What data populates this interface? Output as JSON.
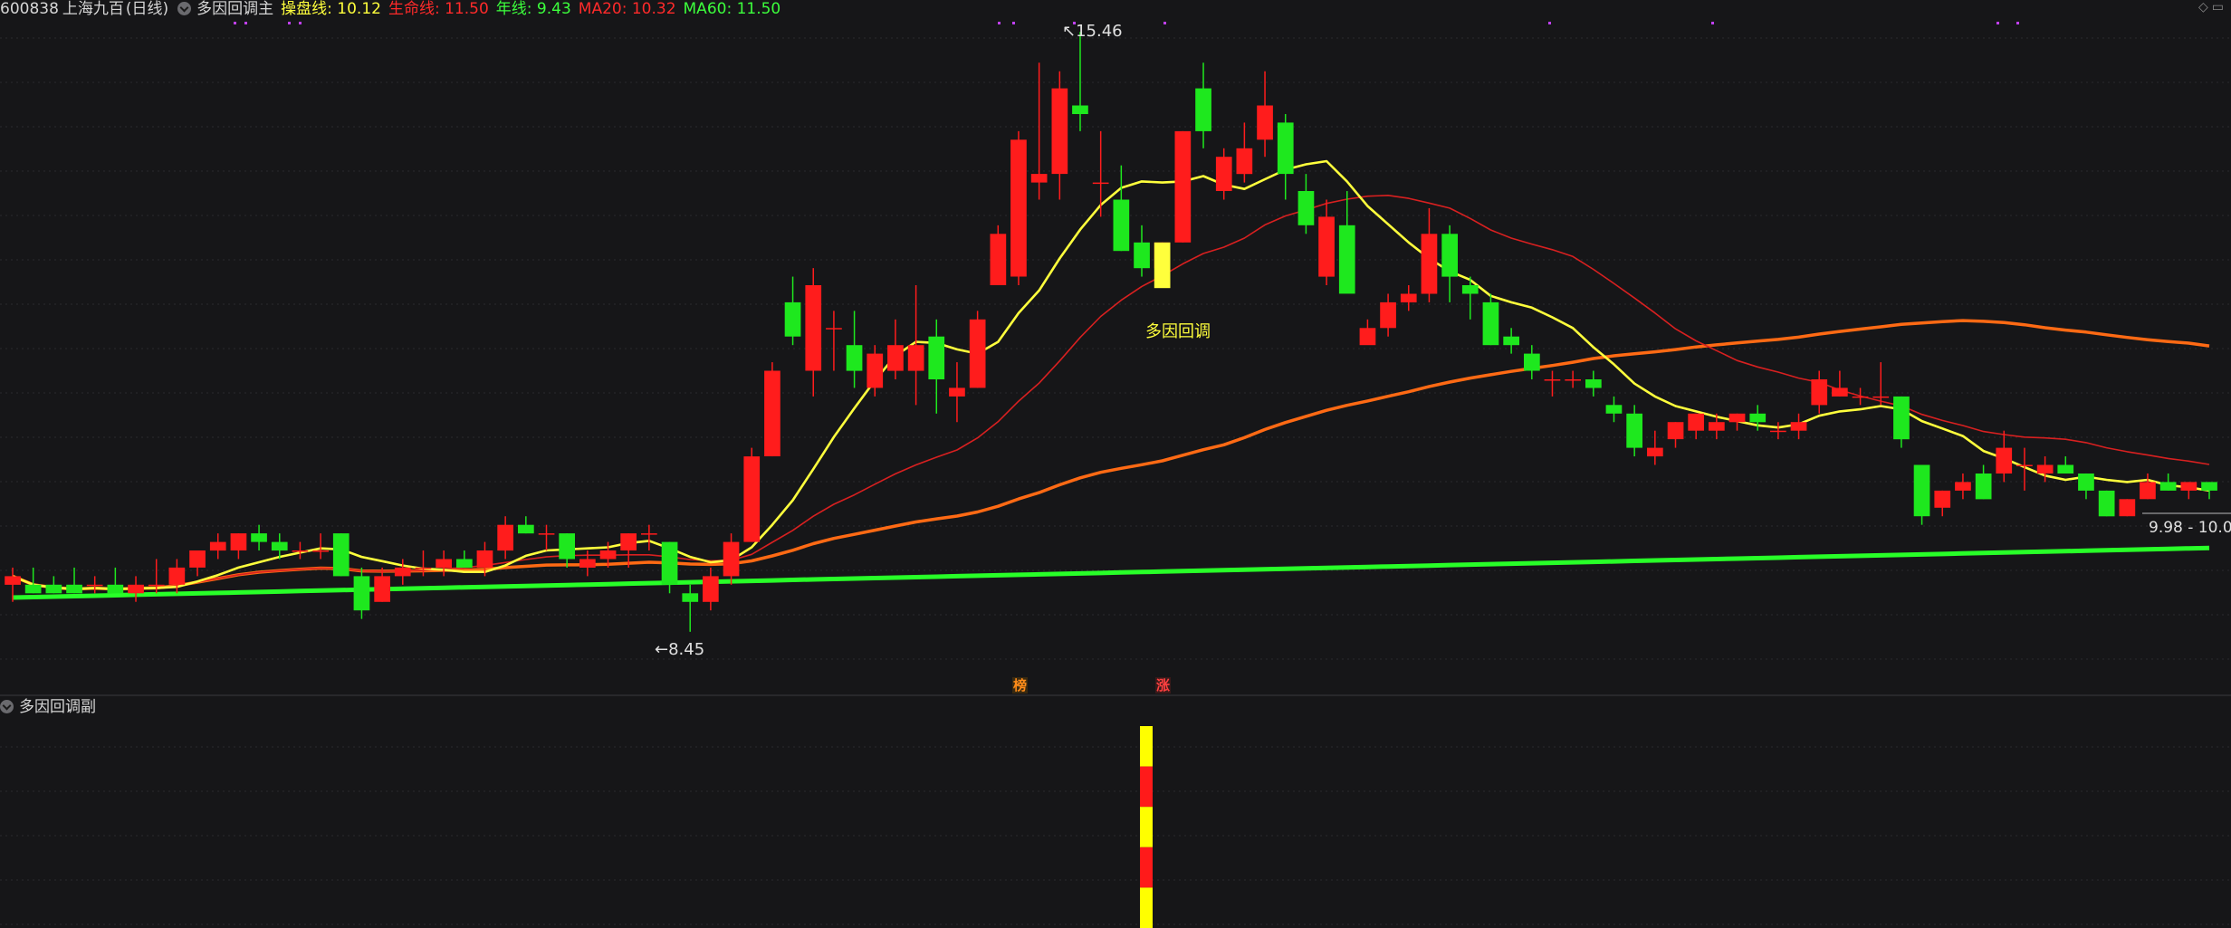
{
  "header": {
    "code": "600838",
    "name": "上海九百",
    "period": "(日线)",
    "indicator_name": "多因回调主",
    "indicators": [
      {
        "label": "操盘线: 10.12",
        "color": "#ffff3c"
      },
      {
        "label": "生命线: 11.50",
        "color": "#ff2a2a"
      },
      {
        "label": "年线: 9.43",
        "color": "#3cff3c"
      },
      {
        "label": "MA20: 10.32",
        "color": "#ff2a2a"
      },
      {
        "label": "MA60: 11.50",
        "color": "#3cff3c"
      }
    ]
  },
  "sub_panel": {
    "name": "多因回调副"
  },
  "annotations": {
    "high_label": "15.46",
    "low_label": "8.45",
    "signal_label": "多因回调",
    "range_label": "9.98 - 10.0",
    "tag_bang": "榜",
    "tag_zhang": "涨"
  },
  "colors": {
    "up": "#ff1c1c",
    "down": "#1ee81e",
    "yellow_line": "#ffff3c",
    "red_line": "#d82020",
    "orange_line": "#ff6a14",
    "green_line": "#28ff28",
    "grid": "#2a2a2e",
    "purple": "#c040ff"
  },
  "candles": [
    {
      "o": 9.0,
      "h": 9.2,
      "l": 8.8,
      "c": 9.1
    },
    {
      "o": 9.0,
      "h": 9.2,
      "l": 8.9,
      "c": 8.9
    },
    {
      "o": 9.0,
      "h": 9.1,
      "l": 8.9,
      "c": 8.9
    },
    {
      "o": 9.0,
      "h": 9.2,
      "l": 8.9,
      "c": 8.9
    },
    {
      "o": 9.0,
      "h": 9.1,
      "l": 8.9,
      "c": 9.0
    },
    {
      "o": 9.0,
      "h": 9.2,
      "l": 8.9,
      "c": 8.9
    },
    {
      "o": 8.9,
      "h": 9.1,
      "l": 8.8,
      "c": 9.0
    },
    {
      "o": 9.0,
      "h": 9.3,
      "l": 8.9,
      "c": 9.0
    },
    {
      "o": 9.0,
      "h": 9.3,
      "l": 8.9,
      "c": 9.2
    },
    {
      "o": 9.2,
      "h": 9.4,
      "l": 9.1,
      "c": 9.4
    },
    {
      "o": 9.4,
      "h": 9.6,
      "l": 9.3,
      "c": 9.5
    },
    {
      "o": 9.4,
      "h": 9.6,
      "l": 9.3,
      "c": 9.6
    },
    {
      "o": 9.6,
      "h": 9.7,
      "l": 9.4,
      "c": 9.5
    },
    {
      "o": 9.5,
      "h": 9.6,
      "l": 9.3,
      "c": 9.4
    },
    {
      "o": 9.4,
      "h": 9.5,
      "l": 9.3,
      "c": 9.4
    },
    {
      "o": 9.4,
      "h": 9.6,
      "l": 9.3,
      "c": 9.4
    },
    {
      "o": 9.6,
      "h": 9.6,
      "l": 9.1,
      "c": 9.1
    },
    {
      "o": 9.1,
      "h": 9.2,
      "l": 8.6,
      "c": 8.7
    },
    {
      "o": 8.8,
      "h": 9.2,
      "l": 8.8,
      "c": 9.1
    },
    {
      "o": 9.1,
      "h": 9.3,
      "l": 9.0,
      "c": 9.2
    },
    {
      "o": 9.2,
      "h": 9.4,
      "l": 9.1,
      "c": 9.2
    },
    {
      "o": 9.2,
      "h": 9.4,
      "l": 9.1,
      "c": 9.3
    },
    {
      "o": 9.3,
      "h": 9.4,
      "l": 9.2,
      "c": 9.2
    },
    {
      "o": 9.2,
      "h": 9.5,
      "l": 9.1,
      "c": 9.4
    },
    {
      "o": 9.4,
      "h": 9.8,
      "l": 9.3,
      "c": 9.7
    },
    {
      "o": 9.7,
      "h": 9.8,
      "l": 9.6,
      "c": 9.6
    },
    {
      "o": 9.6,
      "h": 9.7,
      "l": 9.4,
      "c": 9.6
    },
    {
      "o": 9.6,
      "h": 9.6,
      "l": 9.2,
      "c": 9.3
    },
    {
      "o": 9.2,
      "h": 9.4,
      "l": 9.1,
      "c": 9.3
    },
    {
      "o": 9.3,
      "h": 9.5,
      "l": 9.2,
      "c": 9.4
    },
    {
      "o": 9.4,
      "h": 9.6,
      "l": 9.2,
      "c": 9.6
    },
    {
      "o": 9.6,
      "h": 9.7,
      "l": 9.4,
      "c": 9.6
    },
    {
      "o": 9.5,
      "h": 9.5,
      "l": 8.9,
      "c": 9.0
    },
    {
      "o": 8.9,
      "h": 9.0,
      "l": 8.45,
      "c": 8.8
    },
    {
      "o": 8.8,
      "h": 9.2,
      "l": 8.7,
      "c": 9.1
    },
    {
      "o": 9.1,
      "h": 9.6,
      "l": 9.0,
      "c": 9.5
    },
    {
      "o": 9.5,
      "h": 10.6,
      "l": 9.5,
      "c": 10.5
    },
    {
      "o": 10.5,
      "h": 11.6,
      "l": 10.5,
      "c": 11.5
    },
    {
      "o": 12.3,
      "h": 12.6,
      "l": 11.8,
      "c": 11.9
    },
    {
      "o": 11.5,
      "h": 12.7,
      "l": 11.2,
      "c": 12.5
    },
    {
      "o": 12.0,
      "h": 12.2,
      "l": 11.5,
      "c": 12.0
    },
    {
      "o": 11.8,
      "h": 12.2,
      "l": 11.3,
      "c": 11.5
    },
    {
      "o": 11.3,
      "h": 11.8,
      "l": 11.2,
      "c": 11.7
    },
    {
      "o": 11.5,
      "h": 12.1,
      "l": 11.4,
      "c": 11.8
    },
    {
      "o": 11.5,
      "h": 12.5,
      "l": 11.1,
      "c": 11.8
    },
    {
      "o": 11.9,
      "h": 12.1,
      "l": 11.0,
      "c": 11.4
    },
    {
      "o": 11.2,
      "h": 11.6,
      "l": 10.9,
      "c": 11.3
    },
    {
      "o": 11.3,
      "h": 12.2,
      "l": 11.3,
      "c": 12.1
    },
    {
      "o": 12.5,
      "h": 13.2,
      "l": 12.5,
      "c": 13.1
    },
    {
      "o": 12.6,
      "h": 14.3,
      "l": 12.5,
      "c": 14.2
    },
    {
      "o": 13.7,
      "h": 15.1,
      "l": 13.5,
      "c": 13.8
    },
    {
      "o": 13.8,
      "h": 15.0,
      "l": 13.5,
      "c": 14.8
    },
    {
      "o": 14.6,
      "h": 15.46,
      "l": 14.3,
      "c": 14.5
    },
    {
      "o": 13.7,
      "h": 14.3,
      "l": 13.3,
      "c": 13.7
    },
    {
      "o": 13.5,
      "h": 13.9,
      "l": 12.9,
      "c": 12.9
    },
    {
      "o": 13.0,
      "h": 13.2,
      "l": 12.6,
      "c": 12.7
    },
    {
      "o": 12.7,
      "h": 13.0,
      "l": 12.6,
      "c": 13.0
    },
    {
      "o": 13.0,
      "h": 14.3,
      "l": 13.0,
      "c": 14.3
    },
    {
      "o": 14.8,
      "h": 15.1,
      "l": 14.1,
      "c": 14.3
    },
    {
      "o": 13.6,
      "h": 14.1,
      "l": 13.5,
      "c": 14.0
    },
    {
      "o": 13.8,
      "h": 14.4,
      "l": 13.7,
      "c": 14.1
    },
    {
      "o": 14.2,
      "h": 15.0,
      "l": 14.0,
      "c": 14.6
    },
    {
      "o": 14.4,
      "h": 14.5,
      "l": 13.5,
      "c": 13.8
    },
    {
      "o": 13.6,
      "h": 13.8,
      "l": 13.1,
      "c": 13.2
    },
    {
      "o": 12.6,
      "h": 13.5,
      "l": 12.5,
      "c": 13.3
    },
    {
      "o": 13.2,
      "h": 13.6,
      "l": 12.6,
      "c": 12.4
    },
    {
      "o": 11.8,
      "h": 12.1,
      "l": 11.9,
      "c": 12.0
    },
    {
      "o": 12.0,
      "h": 12.4,
      "l": 11.9,
      "c": 12.3
    },
    {
      "o": 12.3,
      "h": 12.5,
      "l": 12.2,
      "c": 12.4
    },
    {
      "o": 12.4,
      "h": 13.4,
      "l": 12.3,
      "c": 13.1
    },
    {
      "o": 13.1,
      "h": 13.2,
      "l": 12.3,
      "c": 12.6
    },
    {
      "o": 12.5,
      "h": 12.6,
      "l": 12.1,
      "c": 12.4
    },
    {
      "o": 12.3,
      "h": 12.4,
      "l": 11.8,
      "c": 11.8
    },
    {
      "o": 11.9,
      "h": 12.0,
      "l": 11.7,
      "c": 11.8
    },
    {
      "o": 11.7,
      "h": 11.8,
      "l": 11.4,
      "c": 11.5
    },
    {
      "o": 11.4,
      "h": 11.5,
      "l": 11.2,
      "c": 11.4
    },
    {
      "o": 11.4,
      "h": 11.5,
      "l": 11.3,
      "c": 11.4
    },
    {
      "o": 11.4,
      "h": 11.5,
      "l": 11.2,
      "c": 11.3
    },
    {
      "o": 11.1,
      "h": 11.2,
      "l": 10.9,
      "c": 11.0
    },
    {
      "o": 11.0,
      "h": 11.1,
      "l": 10.5,
      "c": 10.6
    },
    {
      "o": 10.5,
      "h": 10.8,
      "l": 10.4,
      "c": 10.6
    },
    {
      "o": 10.7,
      "h": 10.9,
      "l": 10.6,
      "c": 10.9
    },
    {
      "o": 10.8,
      "h": 11.0,
      "l": 10.7,
      "c": 11.0
    },
    {
      "o": 10.8,
      "h": 11.0,
      "l": 10.7,
      "c": 10.9
    },
    {
      "o": 10.9,
      "h": 11.0,
      "l": 10.8,
      "c": 11.0
    },
    {
      "o": 11.0,
      "h": 11.1,
      "l": 10.8,
      "c": 10.9
    },
    {
      "o": 10.8,
      "h": 10.9,
      "l": 10.7,
      "c": 10.8
    },
    {
      "o": 10.8,
      "h": 11.0,
      "l": 10.7,
      "c": 10.9
    },
    {
      "o": 11.1,
      "h": 11.5,
      "l": 11.0,
      "c": 11.4
    },
    {
      "o": 11.2,
      "h": 11.5,
      "l": 11.2,
      "c": 11.3
    },
    {
      "o": 11.2,
      "h": 11.3,
      "l": 11.1,
      "c": 11.2
    },
    {
      "o": 11.2,
      "h": 11.6,
      "l": 11.1,
      "c": 11.2
    },
    {
      "o": 11.2,
      "h": 11.2,
      "l": 10.6,
      "c": 10.7
    },
    {
      "o": 10.4,
      "h": 10.4,
      "l": 9.7,
      "c": 9.8
    },
    {
      "o": 9.9,
      "h": 10.1,
      "l": 9.8,
      "c": 10.1
    },
    {
      "o": 10.1,
      "h": 10.3,
      "l": 10.0,
      "c": 10.2
    },
    {
      "o": 10.3,
      "h": 10.4,
      "l": 10.0,
      "c": 10.0
    },
    {
      "o": 10.3,
      "h": 10.8,
      "l": 10.2,
      "c": 10.6
    },
    {
      "o": 10.4,
      "h": 10.6,
      "l": 10.1,
      "c": 10.4
    },
    {
      "o": 10.3,
      "h": 10.5,
      "l": 10.2,
      "c": 10.4
    },
    {
      "o": 10.4,
      "h": 10.5,
      "l": 10.3,
      "c": 10.3
    },
    {
      "o": 10.3,
      "h": 10.3,
      "l": 10.0,
      "c": 10.1
    },
    {
      "o": 10.1,
      "h": 10.1,
      "l": 9.8,
      "c": 9.8
    },
    {
      "o": 9.8,
      "h": 10.0,
      "l": 9.8,
      "c": 10.0
    },
    {
      "o": 10.0,
      "h": 10.3,
      "l": 10.0,
      "c": 10.2
    },
    {
      "o": 10.2,
      "h": 10.3,
      "l": 10.1,
      "c": 10.1
    },
    {
      "o": 10.1,
      "h": 10.2,
      "l": 10.0,
      "c": 10.2
    },
    {
      "o": 10.2,
      "h": 10.2,
      "l": 10.0,
      "c": 10.1
    }
  ],
  "sub_bars": [
    {
      "color": "#ffff00"
    },
    {
      "color": "#ff1a1a"
    },
    {
      "color": "#ffff00"
    },
    {
      "color": "#ff1a1a"
    },
    {
      "color": "#ffff00"
    }
  ]
}
